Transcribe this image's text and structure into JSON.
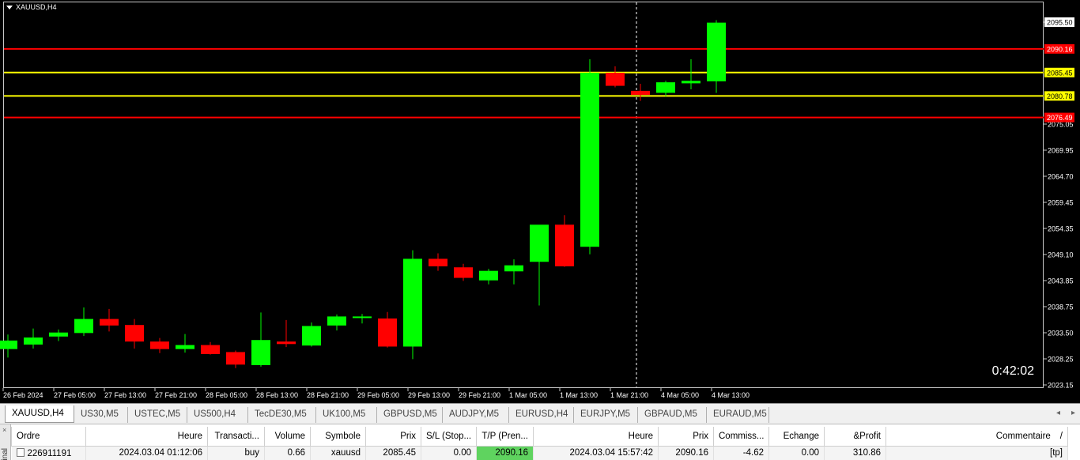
{
  "symbol_title": "XAUUSD,H4",
  "countdown": "0:42:02",
  "colors": {
    "bull": "#00ff00",
    "bear": "#ff0000",
    "tp_sl_line": "#ff0000",
    "entry_line": "#ffff00",
    "background": "#000000",
    "crosshair": "#ffffff"
  },
  "chart_data": {
    "type": "candlestick",
    "price_axis_ticks": [
      "2095.50",
      "2075.05",
      "2069.95",
      "2064.70",
      "2059.45",
      "2054.35",
      "2049.10",
      "2043.85",
      "2038.75",
      "2033.50",
      "2028.25",
      "2023.15"
    ],
    "time_axis_labels": [
      "26 Feb 2024",
      "27 Feb 05:00",
      "27 Feb 13:00",
      "27 Feb 21:00",
      "28 Feb 05:00",
      "28 Feb 13:00",
      "28 Feb 21:00",
      "29 Feb 05:00",
      "29 Feb 13:00",
      "29 Feb 21:00",
      "1 Mar 05:00",
      "1 Mar 13:00",
      "1 Mar 21:00",
      "4 Mar 05:00",
      "4 Mar 13:00"
    ],
    "ylim": [
      2023.15,
      2095.5
    ],
    "price_lines": [
      {
        "label": "2090.16",
        "price": 2090.16,
        "kind": "tp"
      },
      {
        "label": "2085.45",
        "price": 2085.45,
        "kind": "entry"
      },
      {
        "label": "2080.78",
        "price": 2080.78,
        "kind": "entry"
      },
      {
        "label": "2076.49",
        "price": 2076.49,
        "kind": "sl"
      }
    ],
    "last_price_label": "2095.50",
    "candles": [
      {
        "o": 2030.3,
        "h": 2033.2,
        "l": 2028.6,
        "c": 2032.0
      },
      {
        "o": 2031.2,
        "h": 2034.4,
        "l": 2030.4,
        "c": 2032.6
      },
      {
        "o": 2032.8,
        "h": 2034.2,
        "l": 2031.9,
        "c": 2033.6
      },
      {
        "o": 2033.5,
        "h": 2038.6,
        "l": 2032.9,
        "c": 2036.3
      },
      {
        "o": 2036.3,
        "h": 2038.3,
        "l": 2033.8,
        "c": 2035.0
      },
      {
        "o": 2035.1,
        "h": 2036.3,
        "l": 2030.4,
        "c": 2031.8
      },
      {
        "o": 2031.8,
        "h": 2032.5,
        "l": 2029.5,
        "c": 2030.3
      },
      {
        "o": 2030.3,
        "h": 2033.3,
        "l": 2029.6,
        "c": 2031.1
      },
      {
        "o": 2031.1,
        "h": 2031.7,
        "l": 2029.2,
        "c": 2029.3
      },
      {
        "o": 2029.7,
        "h": 2030.0,
        "l": 2026.5,
        "c": 2027.2
      },
      {
        "o": 2027.1,
        "h": 2037.6,
        "l": 2026.8,
        "c": 2032.1
      },
      {
        "o": 2031.8,
        "h": 2036.1,
        "l": 2030.7,
        "c": 2031.3
      },
      {
        "o": 2031.0,
        "h": 2035.6,
        "l": 2030.8,
        "c": 2034.9
      },
      {
        "o": 2035.0,
        "h": 2037.2,
        "l": 2034.0,
        "c": 2036.8
      },
      {
        "o": 2036.5,
        "h": 2037.3,
        "l": 2035.4,
        "c": 2036.8
      },
      {
        "o": 2036.4,
        "h": 2037.7,
        "l": 2030.6,
        "c": 2030.8
      },
      {
        "o": 2030.8,
        "h": 2050.0,
        "l": 2028.3,
        "c": 2048.3
      },
      {
        "o": 2048.3,
        "h": 2049.4,
        "l": 2045.9,
        "c": 2046.8
      },
      {
        "o": 2046.6,
        "h": 2047.3,
        "l": 2043.9,
        "c": 2044.5
      },
      {
        "o": 2044.0,
        "h": 2046.3,
        "l": 2043.2,
        "c": 2045.9
      },
      {
        "o": 2045.8,
        "h": 2048.2,
        "l": 2043.2,
        "c": 2047.0
      },
      {
        "o": 2047.7,
        "h": 2054.2,
        "l": 2039.0,
        "c": 2055.1
      },
      {
        "o": 2055.1,
        "h": 2057.0,
        "l": 2046.7,
        "c": 2046.8
      },
      {
        "o": 2050.7,
        "h": 2088.1,
        "l": 2049.2,
        "c": 2085.4
      },
      {
        "o": 2085.4,
        "h": 2086.7,
        "l": 2082.5,
        "c": 2082.8
      },
      {
        "o": 2081.8,
        "h": 2083.2,
        "l": 2079.8,
        "c": 2081.0
      },
      {
        "o": 2081.4,
        "h": 2083.8,
        "l": 2080.7,
        "c": 2083.5
      },
      {
        "o": 2083.3,
        "h": 2088.1,
        "l": 2082.1,
        "c": 2083.8
      },
      {
        "o": 2083.7,
        "h": 2095.9,
        "l": 2081.4,
        "c": 2095.4
      }
    ]
  },
  "tabs": [
    "XAUUSD,H4",
    "US30,M5",
    "USTEC,M5",
    "US500,H4",
    "TecDE30,M5",
    "UK100,M5",
    "GBPUSD,M5",
    "AUDJPY,M5",
    "EURUSD,H4",
    "EURJPY,M5",
    "GBPAUD,M5",
    "EURAUD,M5"
  ],
  "active_tab": "XAUUSD,H4",
  "terminal": {
    "side_label": "minal",
    "close_glyph": "×",
    "headers": [
      "Ordre",
      "Heure",
      "Transacti...",
      "Volume",
      "Symbole",
      "Prix",
      "S/L (Stop...",
      "T/P (Pren...",
      "Heure",
      "Prix",
      "Commiss...",
      "Echange",
      "&Profit",
      "Commentaire"
    ],
    "sort_glyph": "/",
    "row": [
      "226911191",
      "2024.03.04 01:12:06",
      "buy",
      "0.66",
      "xauusd",
      "2085.45",
      "0.00",
      "2090.16",
      "2024.03.04 15:57:42",
      "2090.16",
      "-4.62",
      "0.00",
      "310.86",
      "[tp]"
    ]
  }
}
